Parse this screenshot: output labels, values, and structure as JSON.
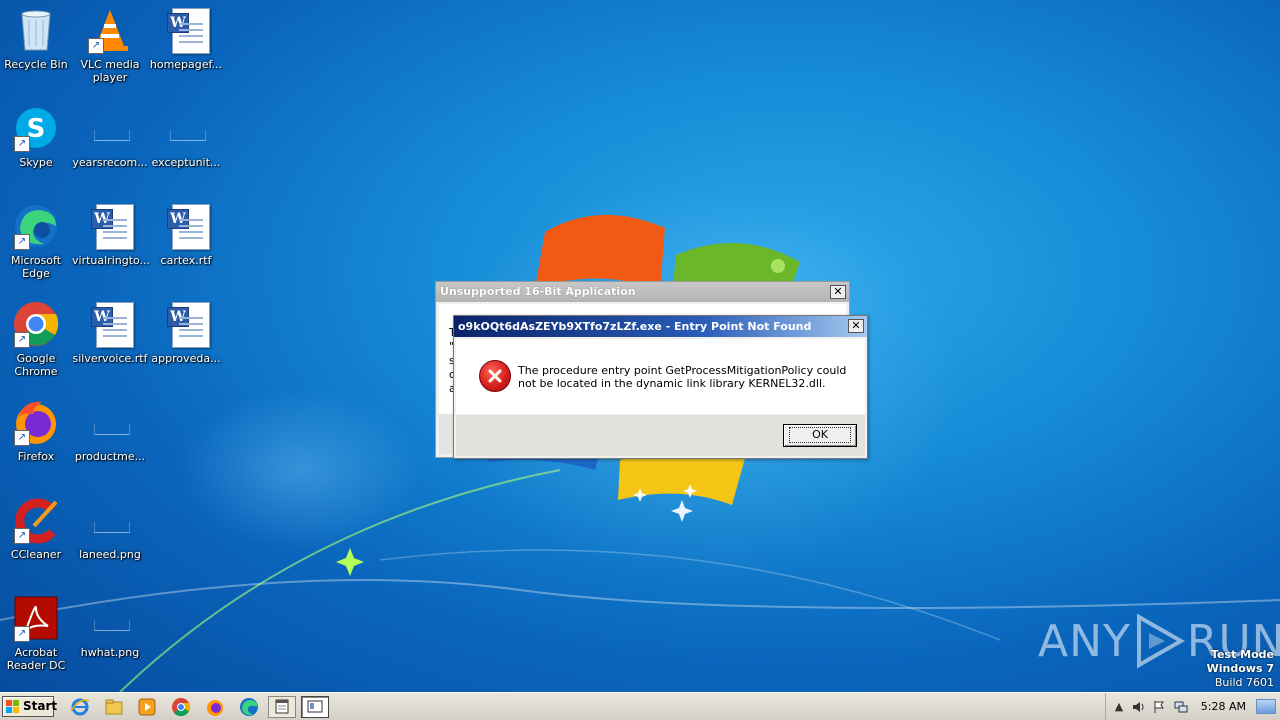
{
  "desktop": {
    "icons": [
      {
        "label": "Recycle Bin"
      },
      {
        "label": "VLC media player"
      },
      {
        "label": "homepagef..."
      },
      {
        "label": "Skype"
      },
      {
        "label": "yearsrecom..."
      },
      {
        "label": "exceptunit..."
      },
      {
        "label": "Microsoft Edge"
      },
      {
        "label": "virtualringto..."
      },
      {
        "label": "cartex.rtf"
      },
      {
        "label": "Google Chrome"
      },
      {
        "label": "silvervoice.rtf"
      },
      {
        "label": "approveda..."
      },
      {
        "label": "Firefox"
      },
      {
        "label": "productme..."
      },
      {
        "label": "CCleaner"
      },
      {
        "label": "laneed.png"
      },
      {
        "label": "Acrobat Reader DC"
      },
      {
        "label": "hwhat.png"
      }
    ]
  },
  "background_dialog": {
    "title": "Unsupported 16-Bit Application",
    "fragments": [
      "T",
      "\"",
      "s",
      "c",
      "a"
    ],
    "close_label": "✕"
  },
  "error_dialog": {
    "title": "o9kOQt6dAsZEYb9XTfo7zLZf.exe - Entry Point Not Found",
    "message": "The procedure entry point GetProcessMitigationPolicy could not be located in the dynamic link library KERNEL32.dll.",
    "ok_label": "OK",
    "close_label": "✕"
  },
  "watermark": {
    "left": "ANY",
    "right": "RUN"
  },
  "test_mode": {
    "line1": "Test Mode",
    "line2": "Windows 7",
    "line3": "Build 7601"
  },
  "taskbar": {
    "start_label": "Start",
    "clock": "5:28 AM"
  },
  "colors": {
    "error_title_start": "#0a246a",
    "error_title_end": "#a6caf0",
    "desktop_blue": "#168bd6"
  }
}
